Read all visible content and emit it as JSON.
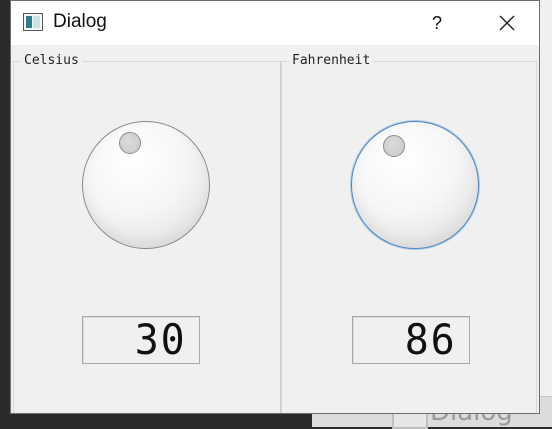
{
  "dialog": {
    "title": "Dialog",
    "help_label": "?"
  },
  "celsius": {
    "group_title": "Celsius",
    "value": "30"
  },
  "fahrenheit": {
    "group_title": "Fahrenheit",
    "value": "86"
  },
  "icons": {
    "app": "app-window-icon",
    "close": "close-icon"
  },
  "background": {
    "ghost_title": "Dialog"
  }
}
